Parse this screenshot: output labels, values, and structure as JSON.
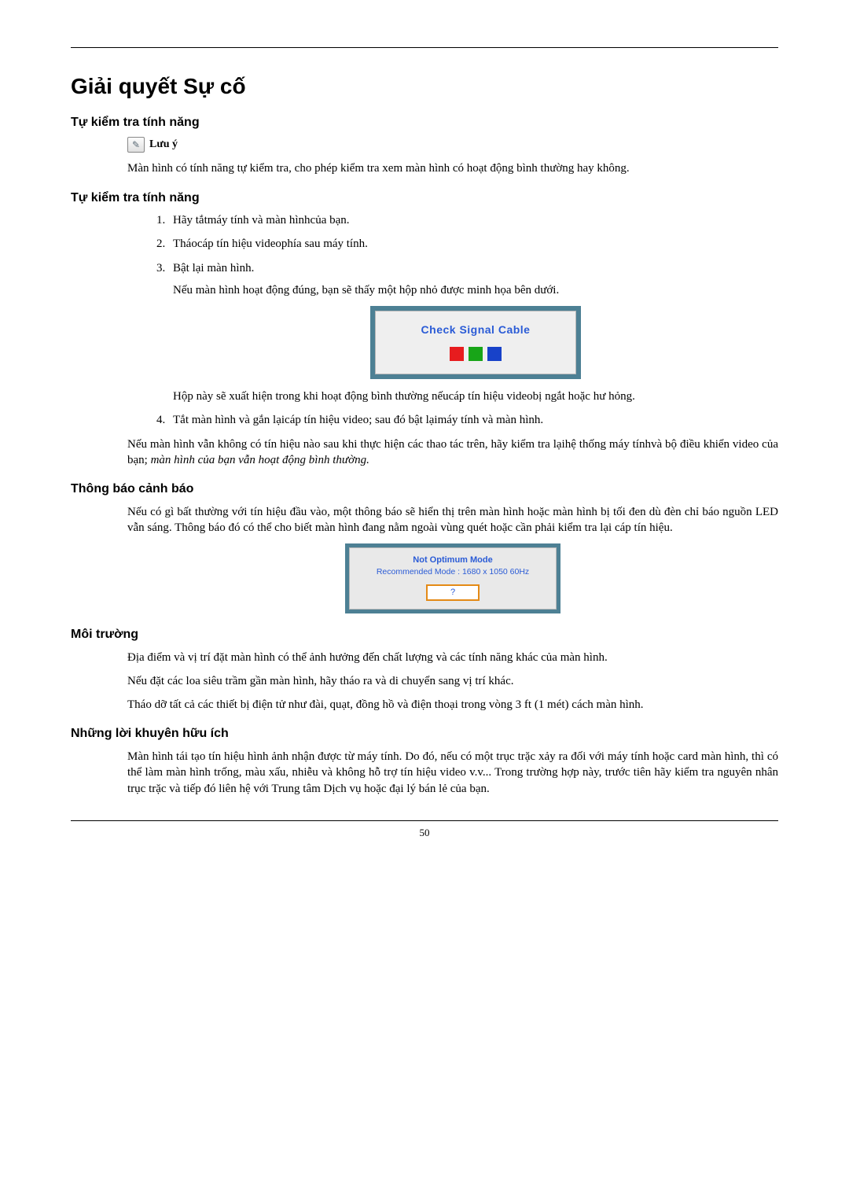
{
  "page_number": "50",
  "h1": "Giải quyết Sự cố",
  "sec1": {
    "heading": "Tự kiểm tra tính năng",
    "note_label": "Lưu ý",
    "p1": "Màn hình có tính năng tự kiểm tra, cho phép kiểm tra xem màn hình có hoạt động bình thường hay không."
  },
  "sec2": {
    "heading": "Tự kiểm tra tính năng",
    "items": {
      "i1": "Hãy tắtmáy tính và màn hìnhcủa bạn.",
      "i2": "Tháocáp tín hiệu videophía sau máy tính.",
      "i3": "Bật lại màn hình.",
      "i3_sub": "Nếu màn hình hoạt động đúng, bạn sẽ thấy một hộp nhỏ được minh họa bên dưới.",
      "i3_sub2": "Hộp này sẽ xuất hiện trong khi hoạt động bình thường nếucáp tín hiệu videobị ngắt hoặc hư hỏng.",
      "i4": "Tắt màn hình và gắn lạicáp tín hiệu video; sau đó bật lạimáy tính và màn hình."
    },
    "after_list_plain": "Nếu màn hình vẫn không có tín hiệu nào sau khi thực hiện các thao tác trên, hãy kiểm tra lạihệ thống máy tínhvà bộ điều khiển video của bạn; ",
    "after_list_italic": "màn hình của bạn vẫn hoạt động bình thường."
  },
  "signal": {
    "text": "Check Signal Cable"
  },
  "sec3": {
    "heading": "Thông báo cảnh báo",
    "p1": "Nếu có gì bất thường với tín hiệu đầu vào, một thông báo sẽ hiển thị trên màn hình hoặc màn hình bị tối đen dù đèn chỉ báo nguồn LED vẫn sáng. Thông báo đó có thể cho biết màn hình đang nằm ngoài vùng quét hoặc cần phải kiểm tra lại cáp tín hiệu."
  },
  "opt": {
    "line1": "Not Optimum Mode",
    "line2": "Recommended Mode : 1680 x 1050 60Hz",
    "btn": "?"
  },
  "sec4": {
    "heading": "Môi trường",
    "p1": "Địa điểm và vị trí đặt màn hình có thể ảnh hưởng đến chất lượng và các tính năng khác của màn hình.",
    "p2": "Nếu đặt các loa siêu trầm gần màn hình, hãy tháo ra và di chuyển sang vị trí khác.",
    "p3": "Tháo dỡ tất cả các thiết bị điện tử như đài, quạt, đồng hồ và điện thoại trong vòng 3 ft (1 mét) cách màn hình."
  },
  "sec5": {
    "heading": "Những lời khuyên hữu ích",
    "p1": "Màn hình tái tạo tín hiệu hình ảnh nhận được từ máy tính. Do đó, nếu có một trục trặc xảy ra đối với máy tính hoặc card màn hình, thì có thể làm màn hình trống, màu xấu, nhiễu và không hỗ trợ tín hiệu video v.v... Trong trường hợp này, trước tiên hãy kiểm tra nguyên nhân trục trặc và tiếp đó liên hệ với Trung tâm Dịch vụ hoặc đại lý bán lẻ của bạn."
  }
}
